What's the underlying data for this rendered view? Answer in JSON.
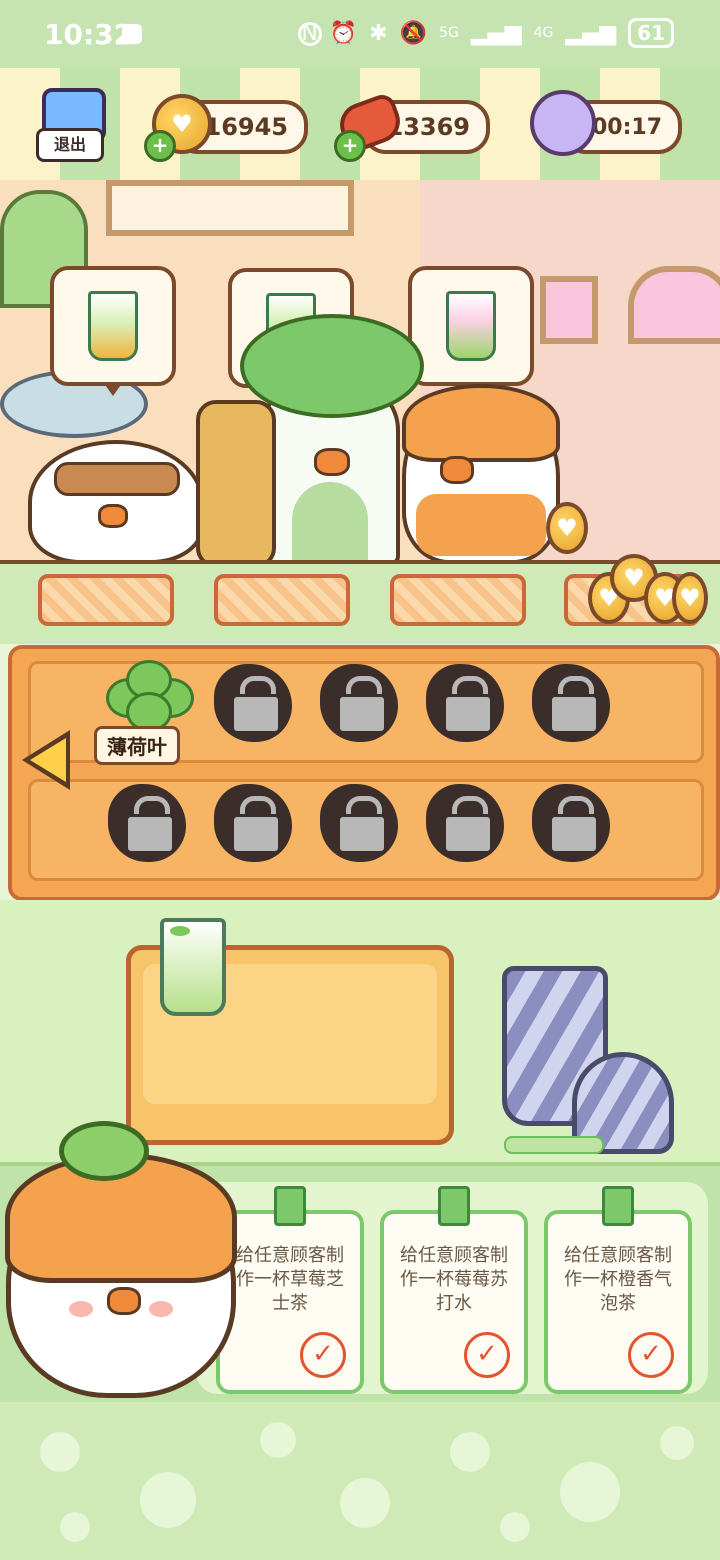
{
  "status_bar": {
    "time": "10:32",
    "signal_5g": "5G",
    "signal_4g": "4G",
    "battery": "61"
  },
  "header": {
    "exit_label": "退出",
    "coins": "16945",
    "meat": "13369",
    "timer": "00:17"
  },
  "shelf": {
    "arrow": "◀",
    "unlocked": [
      {
        "name": "薄荷叶",
        "icon": "mint-leaf-icon"
      }
    ],
    "locked_count": 9
  },
  "tasks": [
    {
      "text": "给任意顾客制作一杯草莓芝士茶"
    },
    {
      "text": "给任意顾客制作一杯莓莓苏打水"
    },
    {
      "text": "给任意顾客制作一杯橙香气泡茶"
    }
  ],
  "colors": {
    "accent_green": "#7dc86a",
    "wood": "#f4a652",
    "outline": "#7b4a2a",
    "check_red": "#e4542e"
  }
}
